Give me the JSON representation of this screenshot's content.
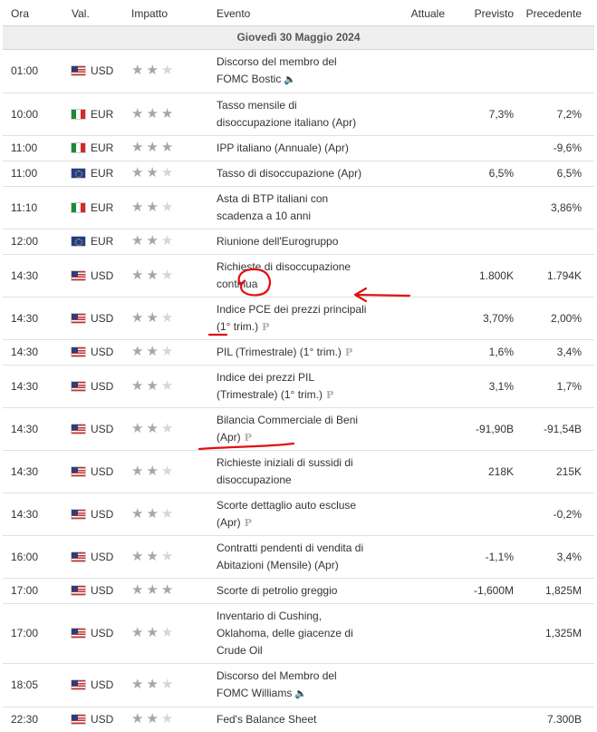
{
  "headers": {
    "time": "Ora",
    "currency": "Val.",
    "impact": "Impatto",
    "event": "Evento",
    "actual": "Attuale",
    "forecast": "Previsto",
    "previous": "Precedente"
  },
  "date_label": "Giovedì 30 Maggio 2024",
  "rows": [
    {
      "time": "01:00",
      "flag": "us",
      "currency": "USD",
      "impact": 2,
      "event": "Discorso del membro del FOMC Bostic",
      "icon": "speaker",
      "actual": "",
      "forecast": "",
      "previous": ""
    },
    {
      "time": "10:00",
      "flag": "it",
      "currency": "EUR",
      "impact": 3,
      "event": "Tasso mensile di disoccupazione italiano (Apr)",
      "icon": "",
      "actual": "",
      "forecast": "7,3%",
      "previous": "7,2%"
    },
    {
      "time": "11:00",
      "flag": "it",
      "currency": "EUR",
      "impact": 3,
      "event": "IPP italiano (Annuale) (Apr)",
      "icon": "",
      "actual": "",
      "forecast": "",
      "previous": "-9,6%"
    },
    {
      "time": "11:00",
      "flag": "eu",
      "currency": "EUR",
      "impact": 2,
      "event": "Tasso di disoccupazione (Apr)",
      "icon": "",
      "actual": "",
      "forecast": "6,5%",
      "previous": "6,5%"
    },
    {
      "time": "11:10",
      "flag": "it",
      "currency": "EUR",
      "impact": 2,
      "event": "Asta di BTP italiani con scadenza a 10 anni",
      "icon": "",
      "actual": "",
      "forecast": "",
      "previous": "3,86%"
    },
    {
      "time": "12:00",
      "flag": "eu",
      "currency": "EUR",
      "impact": 2,
      "event": "Riunione dell'Eurogruppo",
      "icon": "",
      "actual": "",
      "forecast": "",
      "previous": ""
    },
    {
      "time": "14:30",
      "flag": "us",
      "currency": "USD",
      "impact": 2,
      "event": "Richieste di disoccupazione continua",
      "icon": "",
      "actual": "",
      "forecast": "1.800K",
      "previous": "1.794K"
    },
    {
      "time": "14:30",
      "flag": "us",
      "currency": "USD",
      "impact": 2,
      "event": "Indice PCE dei prezzi principali (1° trim.)",
      "icon": "P",
      "actual": "",
      "forecast": "3,70%",
      "previous": "2,00%"
    },
    {
      "time": "14:30",
      "flag": "us",
      "currency": "USD",
      "impact": 2,
      "event": "PIL (Trimestrale) (1° trim.)",
      "icon": "P",
      "actual": "",
      "forecast": "1,6%",
      "previous": "3,4%"
    },
    {
      "time": "14:30",
      "flag": "us",
      "currency": "USD",
      "impact": 2,
      "event": "Indice dei prezzi PIL (Trimestrale) (1° trim.)",
      "icon": "P",
      "actual": "",
      "forecast": "3,1%",
      "previous": "1,7%"
    },
    {
      "time": "14:30",
      "flag": "us",
      "currency": "USD",
      "impact": 2,
      "event": "Bilancia Commerciale di Beni (Apr)",
      "icon": "P",
      "actual": "",
      "forecast": "-91,90B",
      "previous": "-91,54B"
    },
    {
      "time": "14:30",
      "flag": "us",
      "currency": "USD",
      "impact": 2,
      "event": "Richieste iniziali di sussidi di disoccupazione",
      "icon": "",
      "actual": "",
      "forecast": "218K",
      "previous": "215K"
    },
    {
      "time": "14:30",
      "flag": "us",
      "currency": "USD",
      "impact": 2,
      "event": "Scorte dettaglio auto escluse (Apr)",
      "icon": "P",
      "actual": "",
      "forecast": "",
      "previous": "-0,2%"
    },
    {
      "time": "16:00",
      "flag": "us",
      "currency": "USD",
      "impact": 2,
      "event": "Contratti pendenti di vendita di Abitazioni (Mensile) (Apr)",
      "icon": "",
      "actual": "",
      "forecast": "-1,1%",
      "previous": "3,4%"
    },
    {
      "time": "17:00",
      "flag": "us",
      "currency": "USD",
      "impact": 3,
      "event": "Scorte di petrolio greggio",
      "icon": "",
      "actual": "",
      "forecast": "-1,600M",
      "previous": "1,825M"
    },
    {
      "time": "17:00",
      "flag": "us",
      "currency": "USD",
      "impact": 2,
      "event": "Inventario di Cushing, Oklahoma, delle giacenze di Crude Oil",
      "icon": "",
      "actual": "",
      "forecast": "",
      "previous": "1,325M"
    },
    {
      "time": "18:05",
      "flag": "us",
      "currency": "USD",
      "impact": 2,
      "event": "Discorso del Membro del FOMC Williams",
      "icon": "speaker",
      "actual": "",
      "forecast": "",
      "previous": ""
    },
    {
      "time": "22:30",
      "flag": "us",
      "currency": "USD",
      "impact": 2,
      "event": "Fed's Balance Sheet",
      "icon": "",
      "actual": "",
      "forecast": "",
      "previous": "7.300B"
    }
  ],
  "annotation_color": "#e01010"
}
